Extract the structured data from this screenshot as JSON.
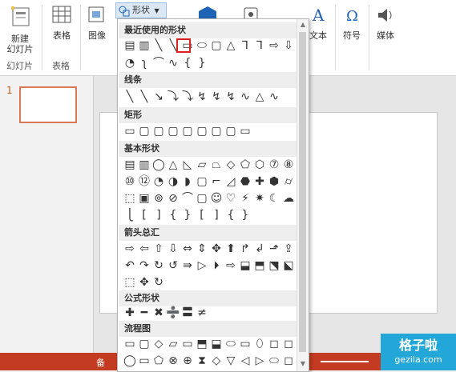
{
  "ribbon": {
    "new_slide": "新建\n幻灯片",
    "slides_group": "幻灯片",
    "table": "表格",
    "tables_group": "表格",
    "image": "图像",
    "shapes": "形状",
    "text": "文本",
    "symbol": "符号",
    "media": "媒体"
  },
  "dropdown": {
    "sections": [
      {
        "title": "最近使用的形状",
        "rows": [
          [
            "▤",
            "▥",
            "╲",
            "╲",
            "▭",
            "⬭",
            "▢",
            "△",
            "⅂",
            "⅂",
            "⇨",
            "⇩"
          ],
          [
            "◔",
            "ʅ",
            "⌒",
            "∿",
            "{",
            "}"
          ]
        ]
      },
      {
        "title": "线条",
        "rows": [
          [
            "╲",
            "╲",
            "↘",
            "⤵",
            "⤵",
            "↯",
            "↯",
            "↯",
            "∿",
            "△",
            "∿"
          ]
        ]
      },
      {
        "title": "矩形",
        "rows": [
          [
            "▭",
            "▢",
            "▢",
            "▢",
            "▢",
            "▢",
            "▢",
            "▢",
            "▭"
          ]
        ]
      },
      {
        "title": "基本形状",
        "rows": [
          [
            "▤",
            "▥",
            "◯",
            "△",
            "◺",
            "▱",
            "⏢",
            "◇",
            "⬠",
            "⬡",
            "⑦",
            "⑧"
          ],
          [
            "⑩",
            "⑫",
            "◔",
            "◑",
            "◗",
            "▢",
            "⌐",
            "◿",
            "⬣",
            "✚",
            "⬢",
            "⌭"
          ],
          [
            "⬚",
            "▣",
            "⊚",
            "⊘",
            "⌒",
            "▢",
            "☺",
            "♡",
            "⚡",
            "✷",
            "☾",
            "☁"
          ],
          [
            "⎩",
            "[",
            "]",
            "{",
            "}",
            "[",
            "]",
            "{",
            "}"
          ]
        ]
      },
      {
        "title": "箭头总汇",
        "rows": [
          [
            "⇨",
            "⇦",
            "⇧",
            "⇩",
            "⇔",
            "⇕",
            "✥",
            "⬆",
            "↱",
            "↲",
            "⬏",
            "⇪"
          ],
          [
            "↶",
            "↷",
            "↻",
            "↺",
            "⇛",
            "▷",
            "⏵",
            "⇨",
            "⬓",
            "⬒",
            "⬔",
            "⬕"
          ],
          [
            "⬚",
            "✥",
            "↻"
          ]
        ]
      },
      {
        "title": "公式形状",
        "rows": [
          [
            "✚",
            "━",
            "✖",
            "➗",
            "〓",
            "≠"
          ]
        ]
      },
      {
        "title": "流程图",
        "rows": [
          [
            "▭",
            "▢",
            "◇",
            "▱",
            "▭",
            "⬒",
            "⬓",
            "⬭",
            "▭",
            "⬯",
            "◻",
            "◻"
          ],
          [
            "◯",
            "▭",
            "⬠",
            "⊗",
            "⊕",
            "⧗",
            "◇",
            "▽",
            "◁",
            "▷",
            "⬭",
            "◻"
          ]
        ]
      }
    ]
  },
  "statusbar": {
    "notes": "备"
  },
  "watermark": {
    "title": "格子啦",
    "url": "gezila.com"
  },
  "slide_panel": {
    "number": "1"
  }
}
